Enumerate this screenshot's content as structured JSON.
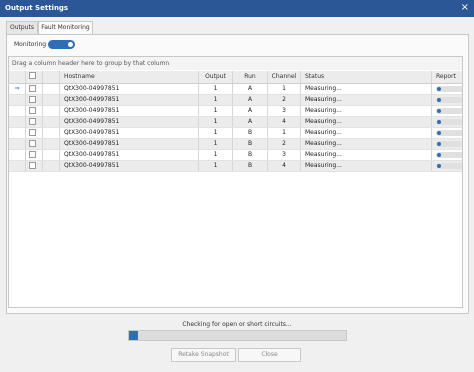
{
  "window": {
    "title": "Output Settings",
    "close_glyph": "×"
  },
  "tabs": [
    {
      "label": "Outputs"
    },
    {
      "label": "Fault Monitoring"
    }
  ],
  "monitoring": {
    "label": "Monitoring",
    "enabled": true
  },
  "grid": {
    "group_hint": "Drag a column header here to group by that column",
    "columns": [
      "Hostname",
      "Output",
      "Run",
      "Channel",
      "Status",
      "Report"
    ],
    "current_row_glyph": "⇒",
    "rows": [
      {
        "hostname": "QtX300-04997851",
        "output": "1",
        "run": "A",
        "channel": "1",
        "status": "Measuring..."
      },
      {
        "hostname": "QtX300-04997851",
        "output": "1",
        "run": "A",
        "channel": "2",
        "status": "Measuring..."
      },
      {
        "hostname": "QtX300-04997851",
        "output": "1",
        "run": "A",
        "channel": "3",
        "status": "Measuring..."
      },
      {
        "hostname": "QtX300-04997851",
        "output": "1",
        "run": "A",
        "channel": "4",
        "status": "Measuring..."
      },
      {
        "hostname": "QtX300-04997851",
        "output": "1",
        "run": "B",
        "channel": "1",
        "status": "Measuring..."
      },
      {
        "hostname": "QtX300-04997851",
        "output": "1",
        "run": "B",
        "channel": "2",
        "status": "Measuring..."
      },
      {
        "hostname": "QtX300-04997851",
        "output": "1",
        "run": "B",
        "channel": "3",
        "status": "Measuring..."
      },
      {
        "hostname": "QtX300-04997851",
        "output": "1",
        "run": "B",
        "channel": "4",
        "status": "Measuring..."
      }
    ]
  },
  "footer": {
    "status_text": "Checking for open or short circuits...",
    "progress_fraction": 0.04,
    "retake_label": "Retake Snapshot",
    "close_label": "Close"
  },
  "colors": {
    "title_bar": "#2b5797",
    "accent": "#2f6db5"
  }
}
